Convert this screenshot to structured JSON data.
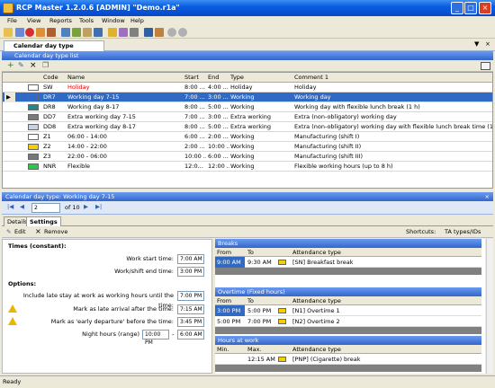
{
  "window": {
    "title": "RCP Master 1.2.0.6  [ADMIN]  \"Demo.r1a\""
  },
  "menu": [
    "File",
    "View",
    "Reports",
    "Tools",
    "Window",
    "Help"
  ],
  "doc_tab": "Calendar day type definitions",
  "list_panel": {
    "title": "Calendar day type list",
    "columns": [
      "Code",
      "Name",
      "Start",
      "End",
      "Type",
      "Comment 1"
    ],
    "rows": [
      {
        "color": "#ffffff",
        "code": "SW",
        "name": "Holiday",
        "start": "8:00 ...",
        "end": "4:00 ...",
        "type": "Holiday",
        "comment": "Holiday"
      },
      {
        "color": "#316ac5",
        "code": "DR7",
        "name": "Working day 7-15",
        "start": "7:00 ...",
        "end": "3:00 ...",
        "type": "Working",
        "comment": "Working day"
      },
      {
        "color": "#1e8a8a",
        "code": "DR8",
        "name": "Working day 8-17",
        "start": "8:00 ...",
        "end": "5:00 ...",
        "type": "Working",
        "comment": "Working day with flexible lunch break (1 h)"
      },
      {
        "color": "#7a7a7a",
        "code": "DD7",
        "name": "Extra working day 7-15",
        "start": "7:00 ...",
        "end": "3:00 ...",
        "type": "Extra working",
        "comment": "Extra (non-obligatory) working day"
      },
      {
        "color": "#c8d0e8",
        "code": "DD8",
        "name": "Extra working day 8-17",
        "start": "8:00 ...",
        "end": "5:00 ...",
        "type": "Extra working",
        "comment": "Extra (non-obligatory) working day with flexible lunch break time (1 h)"
      },
      {
        "color": "#ffffff",
        "code": "Z1",
        "name": "06:00 - 14:00",
        "start": "6:00 ...",
        "end": "2:00 ...",
        "type": "Working",
        "comment": "Manufacturing (shift I)"
      },
      {
        "color": "#f5d000",
        "code": "Z2",
        "name": "14:00 - 22:00",
        "start": "2:00 ...",
        "end": "10:00 ...",
        "type": "Working",
        "comment": "Manufacturing (shift II)"
      },
      {
        "color": "#777777",
        "code": "Z3",
        "name": "22:00 - 06:00",
        "start": "10:00 ...",
        "end": "6:00 ...",
        "type": "Working",
        "comment": "Manufacturing (shift III)"
      },
      {
        "color": "#22cc44",
        "code": "NNR",
        "name": "Flexible",
        "start": "12:0...",
        "end": "12:00 ...",
        "type": "Working",
        "comment": "Flexible working hours (up to 8 h)"
      }
    ]
  },
  "detail": {
    "title": "Calendar day type: Working day 7-15",
    "nav": {
      "current": "2",
      "total": "of 10"
    },
    "tabs": [
      "Details",
      "Settings"
    ],
    "tools": {
      "edit": "Edit",
      "remove": "Remove",
      "shortcuts": "Shortcuts:",
      "ta_types": "TA types/IDs"
    },
    "times_header": "Times (constant):",
    "work_start_label": "Work start time:",
    "work_start": "7:00 AM",
    "work_end_label": "Work/shift end time:",
    "work_end": "3:00 PM",
    "options_header": "Options:",
    "late_stay_label": "Include late stay at work as working hours until the time:",
    "late_stay": "7:00 PM",
    "late_arrival_label": "Mark as late arrival after the time:",
    "late_arrival": "7:15 AM",
    "early_dep_label": "Mark as 'early departure' before the time:",
    "early_dep": "3:45 PM",
    "night_label": "Night hours (range)",
    "night_from": "10:00 PM",
    "night_sep": "-",
    "night_to": "6:00 AM",
    "breaks": {
      "title": "Breaks",
      "cols": [
        "From",
        "To",
        "Attendance type"
      ],
      "rows": [
        {
          "from": "9:00 AM",
          "to": "9:30 AM",
          "att": "[SN] Breakfast break"
        }
      ]
    },
    "overtime": {
      "title": "Overtime (Fixed hours)",
      "cols": [
        "From",
        "To",
        "Attendance type"
      ],
      "rows": [
        {
          "from": "3:00 PM",
          "to": "5:00 PM",
          "att": "[N1] Overtime 1"
        },
        {
          "from": "5:00 PM",
          "to": "7:00 PM",
          "att": "[N2] Overtime 2"
        }
      ]
    },
    "hours": {
      "title": "Hours at work",
      "cols": [
        "Min.",
        "Max.",
        "Attendance type"
      ],
      "rows": [
        {
          "from": "",
          "to": "12:15 AM",
          "att": "[PNP] (Cigarette) break"
        }
      ]
    }
  },
  "status": "Ready"
}
